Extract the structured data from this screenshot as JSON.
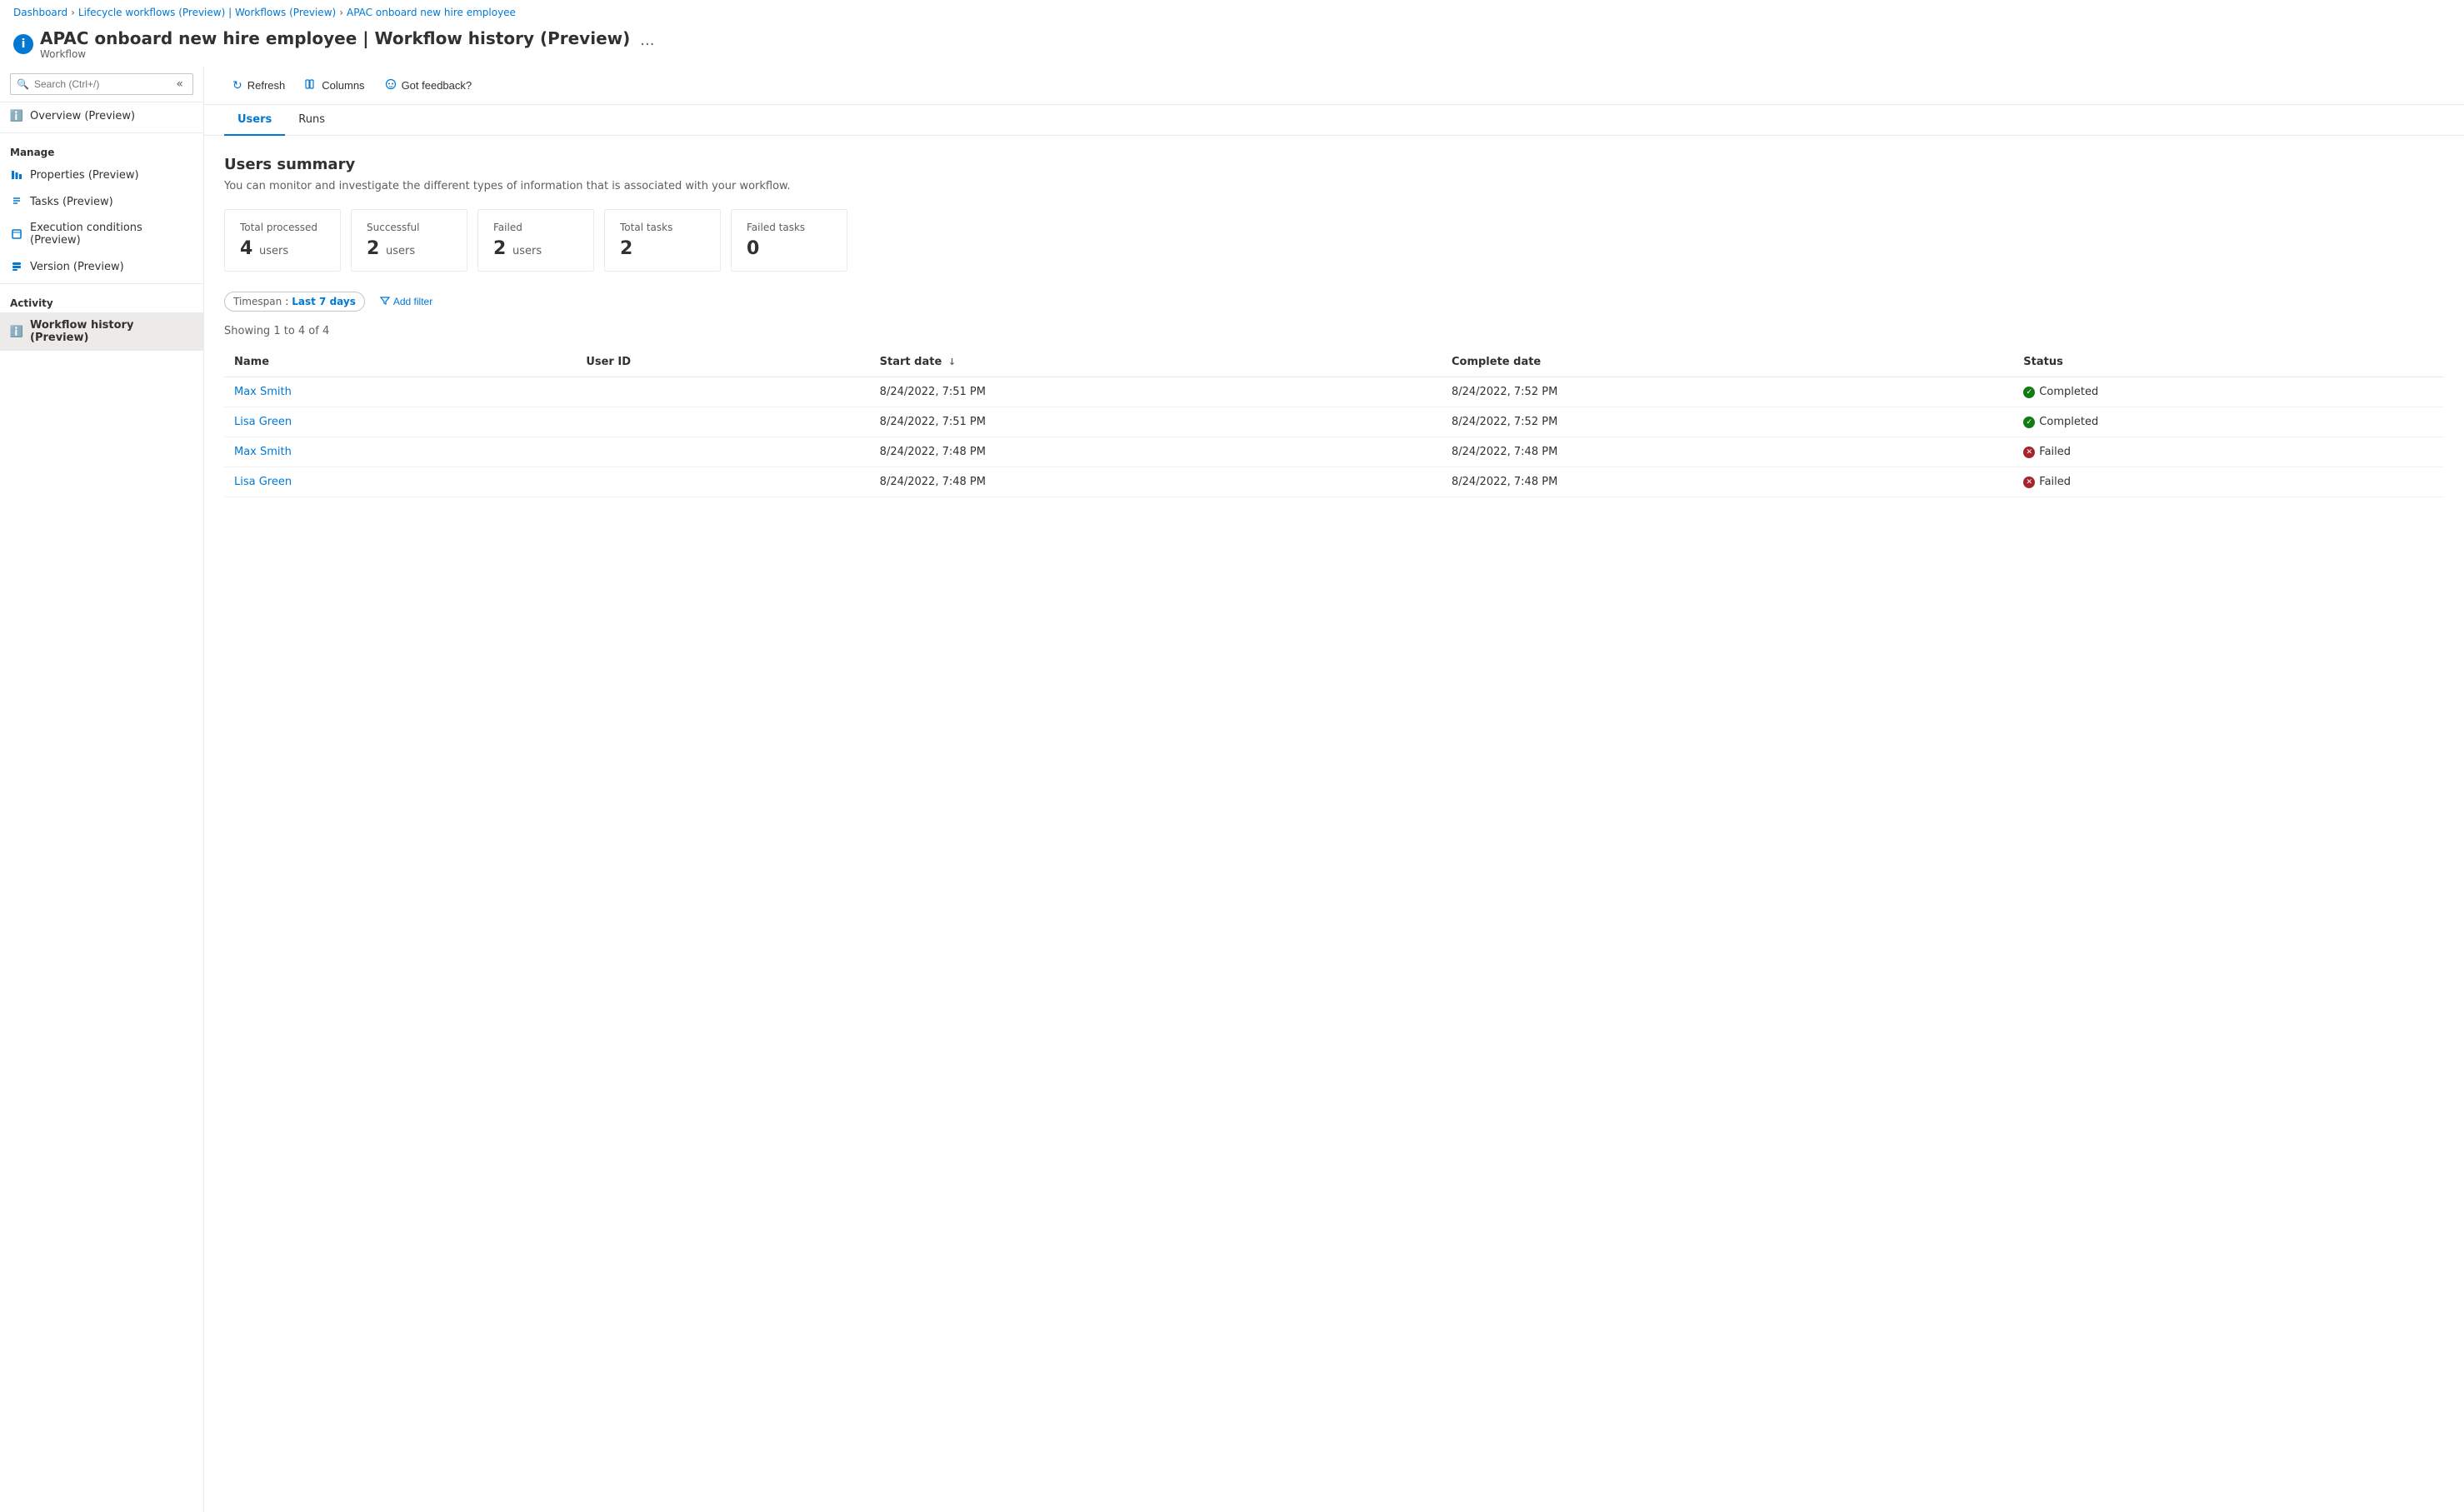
{
  "breadcrumb": {
    "items": [
      {
        "label": "Dashboard",
        "link": true
      },
      {
        "label": "Lifecycle workflows (Preview) | Workflows (Preview)",
        "link": true
      },
      {
        "label": "APAC onboard new hire employee",
        "link": true
      }
    ]
  },
  "page_header": {
    "icon_letter": "i",
    "title": "APAC onboard new hire employee | Workflow history (Preview)",
    "subtitle": "Workflow",
    "more_icon": "···"
  },
  "sidebar": {
    "search_placeholder": "Search (Ctrl+/)",
    "overview_label": "Overview (Preview)",
    "manage_label": "Manage",
    "manage_items": [
      {
        "label": "Properties (Preview)",
        "icon": "bars"
      },
      {
        "label": "Tasks (Preview)",
        "icon": "list"
      },
      {
        "label": "Execution conditions (Preview)",
        "icon": "doc"
      },
      {
        "label": "Version (Preview)",
        "icon": "stack"
      }
    ],
    "activity_label": "Activity",
    "activity_items": [
      {
        "label": "Workflow history (Preview)",
        "icon": "info",
        "active": true
      }
    ]
  },
  "toolbar": {
    "refresh_label": "Refresh",
    "columns_label": "Columns",
    "feedback_label": "Got feedback?"
  },
  "tabs": [
    {
      "label": "Users",
      "active": true
    },
    {
      "label": "Runs",
      "active": false
    }
  ],
  "users_summary": {
    "title": "Users summary",
    "description": "You can monitor and investigate the different types of information that is associated with your workflow.",
    "cards": [
      {
        "label": "Total processed",
        "value": "4",
        "unit": "users"
      },
      {
        "label": "Successful",
        "value": "2",
        "unit": "users"
      },
      {
        "label": "Failed",
        "value": "2",
        "unit": "users"
      },
      {
        "label": "Total tasks",
        "value": "2",
        "unit": ""
      },
      {
        "label": "Failed tasks",
        "value": "0",
        "unit": ""
      }
    ]
  },
  "filters": {
    "timespan_label": "Timespan",
    "timespan_value": "Last 7 days",
    "add_filter_label": "Add filter"
  },
  "table": {
    "showing_text": "Showing 1 to 4 of 4",
    "columns": [
      {
        "label": "Name",
        "sortable": false
      },
      {
        "label": "User ID",
        "sortable": false
      },
      {
        "label": "Start date",
        "sortable": true,
        "sort_dir": "↓"
      },
      {
        "label": "Complete date",
        "sortable": false
      },
      {
        "label": "Status",
        "sortable": false
      }
    ],
    "rows": [
      {
        "name": "Max Smith",
        "user_id": "",
        "start_date": "8/24/2022, 7:51 PM",
        "complete_date": "8/24/2022, 7:52 PM",
        "status": "Completed",
        "status_type": "completed"
      },
      {
        "name": "Lisa Green",
        "user_id": "",
        "start_date": "8/24/2022, 7:51 PM",
        "complete_date": "8/24/2022, 7:52 PM",
        "status": "Completed",
        "status_type": "completed"
      },
      {
        "name": "Max Smith",
        "user_id": "",
        "start_date": "8/24/2022, 7:48 PM",
        "complete_date": "8/24/2022, 7:48 PM",
        "status": "Failed",
        "status_type": "failed"
      },
      {
        "name": "Lisa Green",
        "user_id": "",
        "start_date": "8/24/2022, 7:48 PM",
        "complete_date": "8/24/2022, 7:48 PM",
        "status": "Failed",
        "status_type": "failed"
      }
    ]
  }
}
